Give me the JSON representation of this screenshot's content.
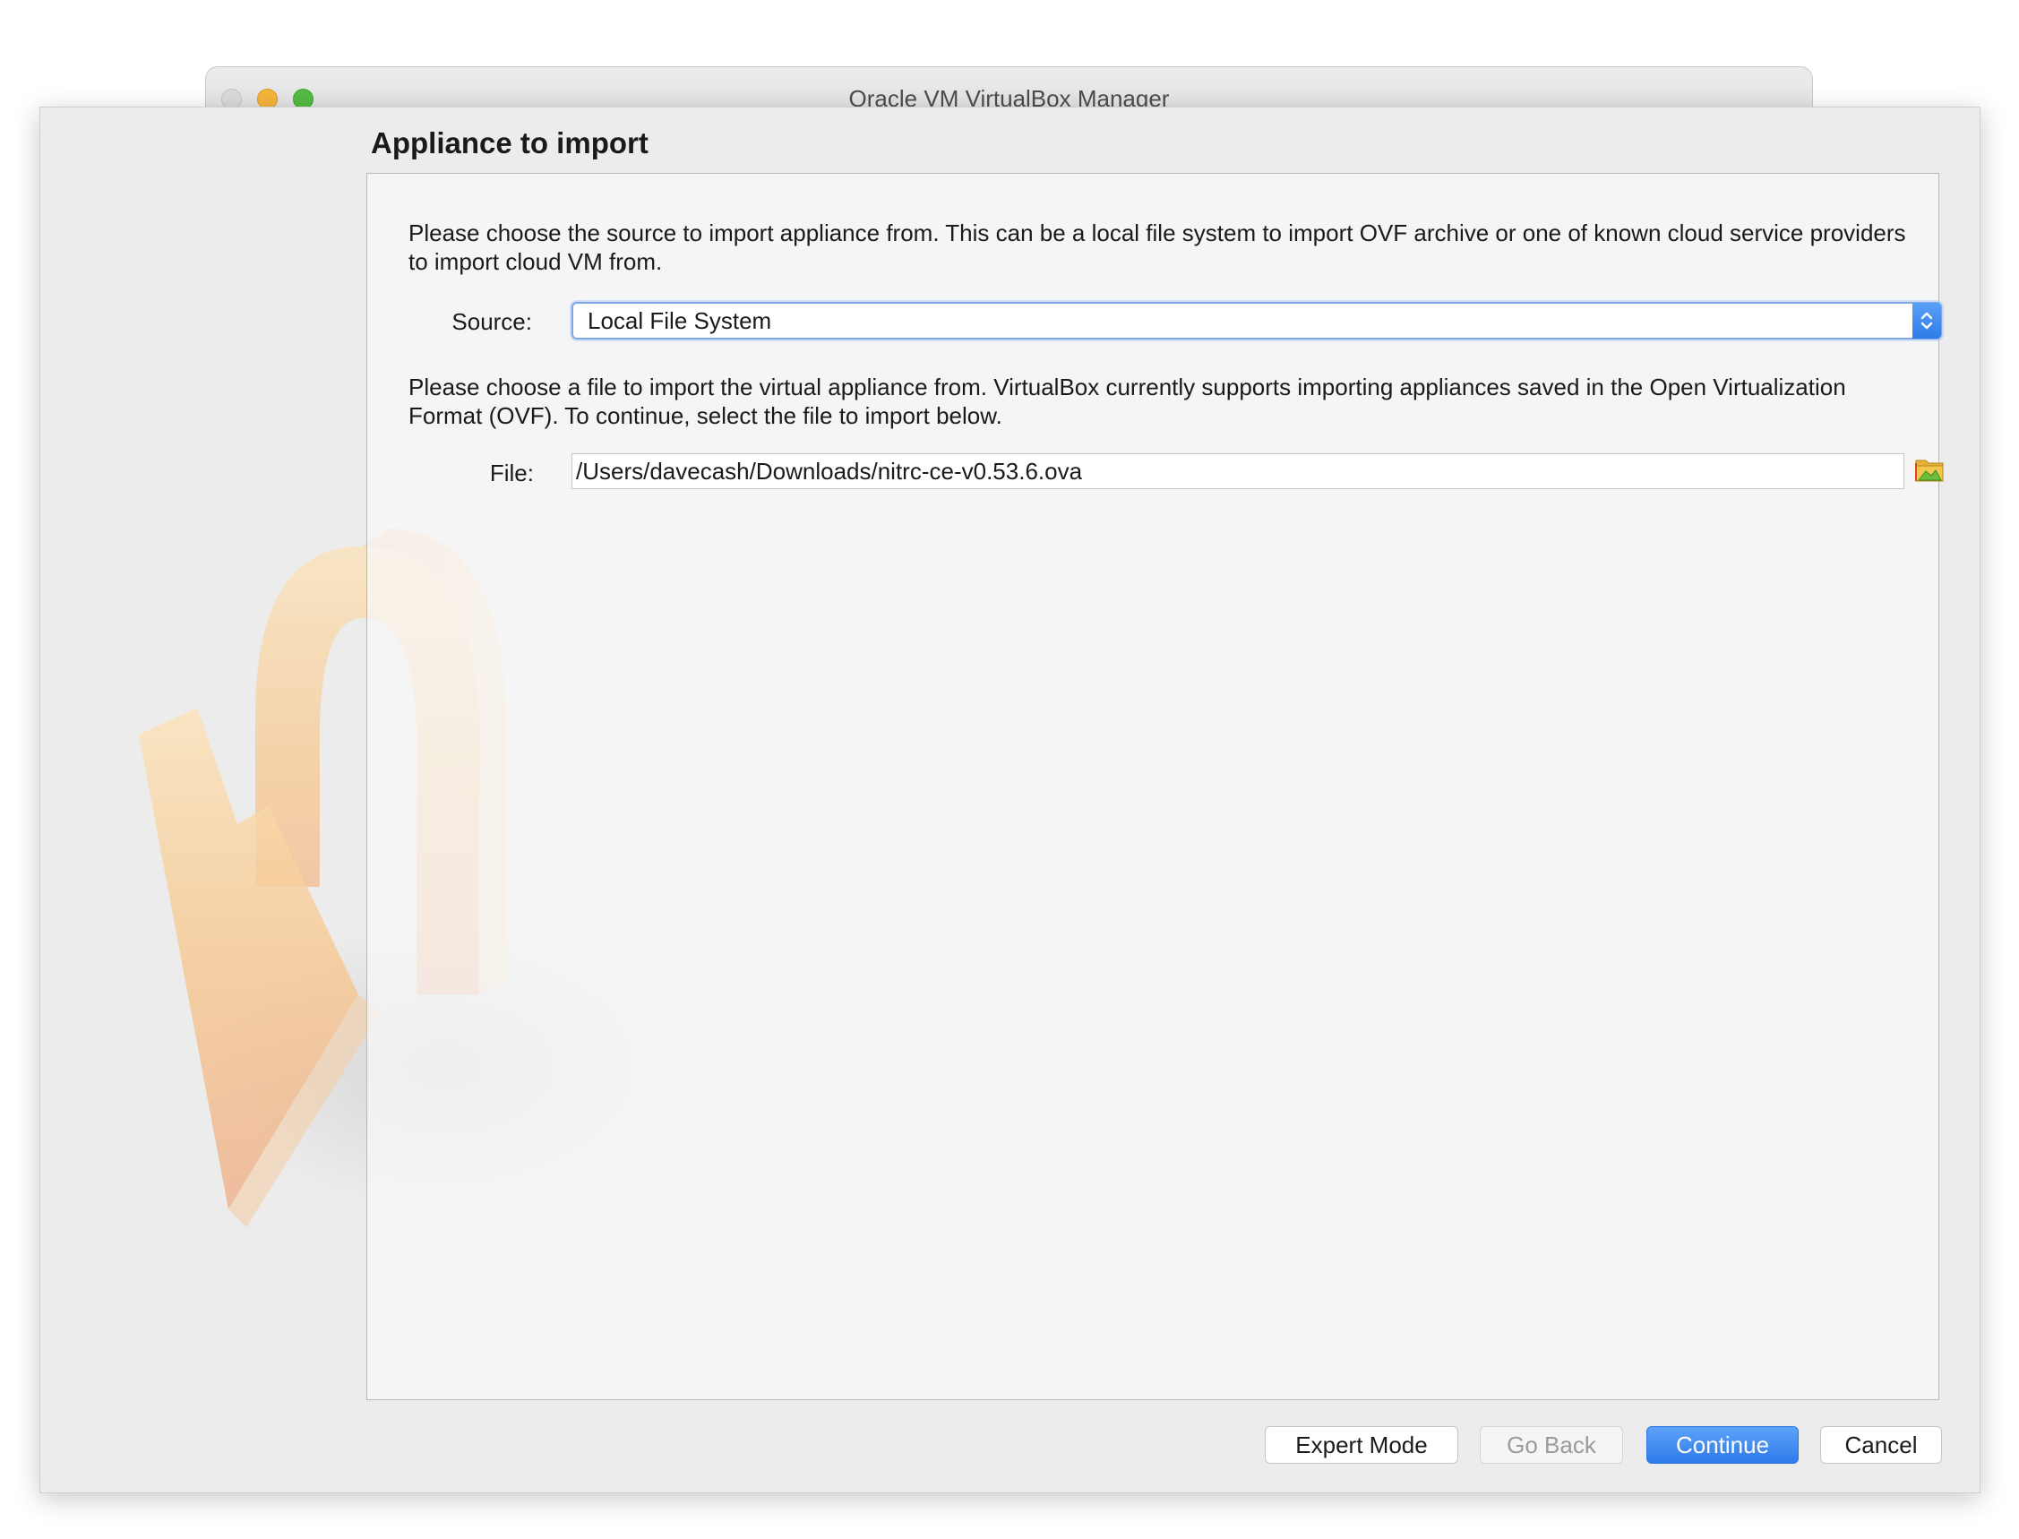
{
  "window": {
    "title": "Oracle VM VirtualBox Manager"
  },
  "dialog": {
    "title": "Appliance to import",
    "source_description": "Please choose the source to import appliance from. This can be a local file system to import OVF archive or one of known cloud service providers to import cloud VM from.",
    "source_label": "Source:",
    "source_value": "Local File System",
    "file_description": "Please choose a file to import the virtual appliance from. VirtualBox currently supports importing appliances saved in the Open Virtualization Format (OVF). To continue, select the file to import below.",
    "file_label": "File:",
    "file_value": "/Users/davecash/Downloads/nitrc-ce-v0.53.6.ova",
    "folder_icon": "folder-icon",
    "watermark_icon": "import-arrow-icon"
  },
  "buttons": {
    "expert_mode": "Expert Mode",
    "go_back": "Go Back",
    "continue": "Continue",
    "cancel": "Cancel"
  },
  "colors": {
    "accent": "#2f7ce8",
    "watermark": "#f6c48f"
  }
}
